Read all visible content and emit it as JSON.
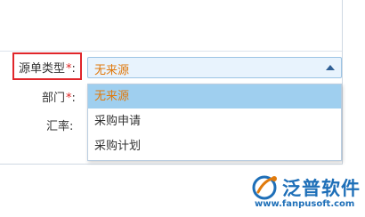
{
  "form": {
    "source_type_label": "源单类型",
    "required_mark": "*",
    "colon": ":",
    "department_label": "部门",
    "exchange_rate_label": "汇率",
    "source_type_value": "无来源"
  },
  "dropdown": {
    "options": [
      "无来源",
      "采购申请",
      "采购计划"
    ],
    "selected_index": 0
  },
  "logo": {
    "name": "泛普软件",
    "url": "www.fanpusoft.com"
  },
  "colors": {
    "accent_orange": "#e07a0c",
    "selected_bg": "#9fcfef",
    "highlight_red": "#e0262b",
    "brand_blue": "#1e6fb8"
  },
  "icons": {
    "select_arrow": "triangle-up",
    "logo_mark": "fanpu-logo"
  }
}
